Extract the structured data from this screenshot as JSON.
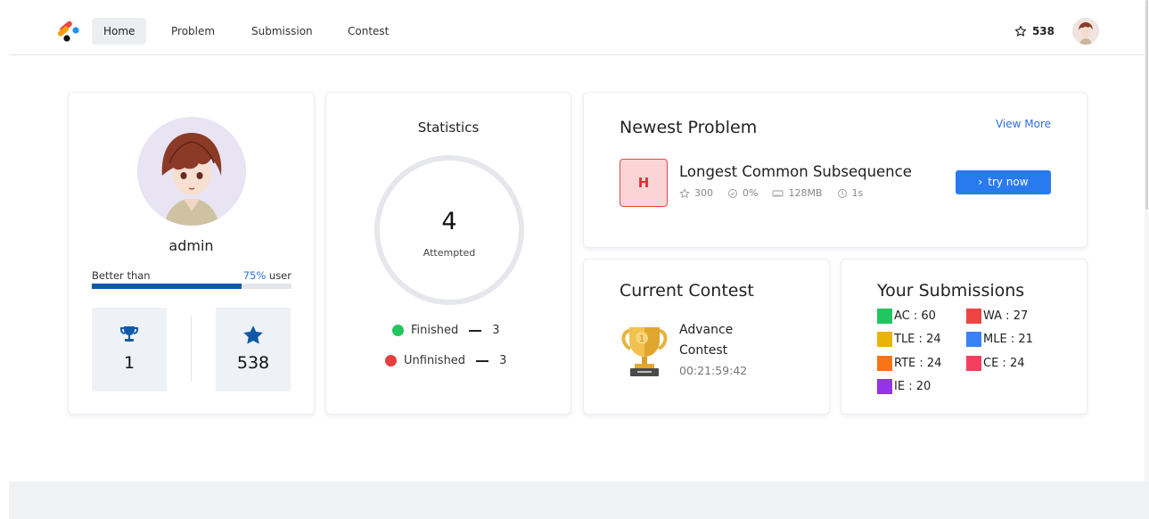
{
  "nav": {
    "items": [
      {
        "label": "Home",
        "active": true
      },
      {
        "label": "Problem",
        "active": false
      },
      {
        "label": "Submission",
        "active": false
      },
      {
        "label": "Contest",
        "active": false
      }
    ],
    "star_count": "538"
  },
  "profile": {
    "username": "admin",
    "better_than_label": "Better than",
    "better_than_pct": "75%",
    "better_than_suffix": " user",
    "better_than_value": 0.75,
    "trophies": "1",
    "stars": "538"
  },
  "statistics": {
    "title": "Statistics",
    "attempted_count": "4",
    "attempted_label": "Attempted",
    "finished_label": "Finished",
    "finished_count": "3",
    "unfinished_label": "Unfinished",
    "unfinished_count": "3",
    "colors": {
      "finished": "#22c55e",
      "unfinished": "#e53e3e"
    }
  },
  "newest_problem": {
    "title": "Newest Problem",
    "view_more": "View More",
    "difficulty": "H",
    "name": "Longest Common Subsequence",
    "points": "300",
    "acceptance": "0%",
    "memory": "128MB",
    "time": "1s",
    "try_label": "try now"
  },
  "current_contest": {
    "title": "Current Contest",
    "name": "Advance Contest",
    "time_left": "00:21:59:42"
  },
  "submissions": {
    "title": "Your Submissions",
    "items": [
      {
        "label": "AC",
        "count": "60",
        "color": "#22c55e"
      },
      {
        "label": "WA",
        "count": "27",
        "color": "#ef4444"
      },
      {
        "label": "TLE",
        "count": "24",
        "color": "#eab308"
      },
      {
        "label": "MLE",
        "count": "21",
        "color": "#3b82f6"
      },
      {
        "label": "RTE",
        "count": "24",
        "color": "#f97316"
      },
      {
        "label": "CE",
        "count": "24",
        "color": "#f43f5e"
      },
      {
        "label": "IE",
        "count": "20",
        "color": "#9333ea"
      }
    ]
  }
}
